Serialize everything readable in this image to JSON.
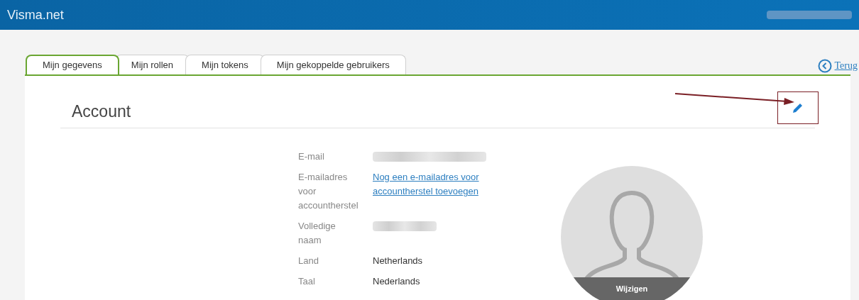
{
  "header": {
    "title": "Visma.net",
    "user": {
      "kind": "redacted"
    }
  },
  "tabs": [
    {
      "label": "Mijn gegevens",
      "selected": true
    },
    {
      "label": "Mijn rollen",
      "selected": false
    },
    {
      "label": "Mijn tokens",
      "selected": false
    },
    {
      "label": "Mijn gekoppelde gebruikers",
      "selected": false
    }
  ],
  "back_link": "Terug",
  "section": {
    "title": "Account"
  },
  "fields": [
    {
      "label": "E-mail",
      "kind": "redacted"
    },
    {
      "label": "E-mailadres voor accountherstel",
      "kind": "link",
      "value": "Nog een e-mailadres voor accountherstel toevoegen"
    },
    {
      "label": "Volledige naam",
      "kind": "redacted"
    },
    {
      "label": "Land",
      "kind": "text",
      "value": "Netherlands"
    },
    {
      "label": "Taal",
      "kind": "text",
      "value": "Nederlands"
    }
  ],
  "avatar": {
    "button": "Wijzigen"
  }
}
